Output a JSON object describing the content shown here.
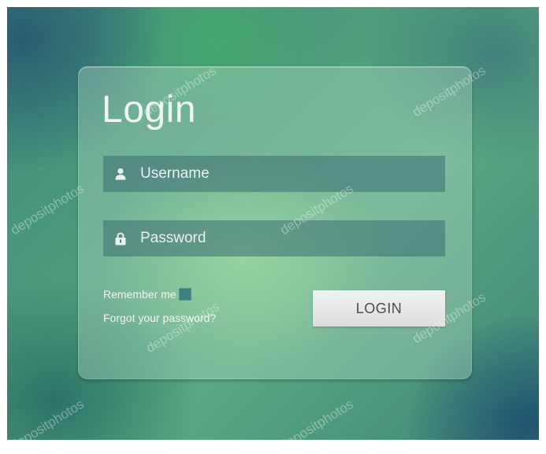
{
  "login_card": {
    "title": "Login",
    "username_label": "Username",
    "password_label": "Password",
    "remember_label": "Remember me",
    "forgot_label": "Forgot your password?",
    "login_button_label": "LOGIN"
  },
  "icons": {
    "username": "user-icon",
    "password": "lock-icon"
  },
  "watermark": {
    "text": "depositphotos"
  },
  "colors": {
    "title_text": "#eef6f1",
    "field_background": "#3c6e73",
    "checkbox": "#3f7f80",
    "button_text": "#4b4b4b"
  }
}
